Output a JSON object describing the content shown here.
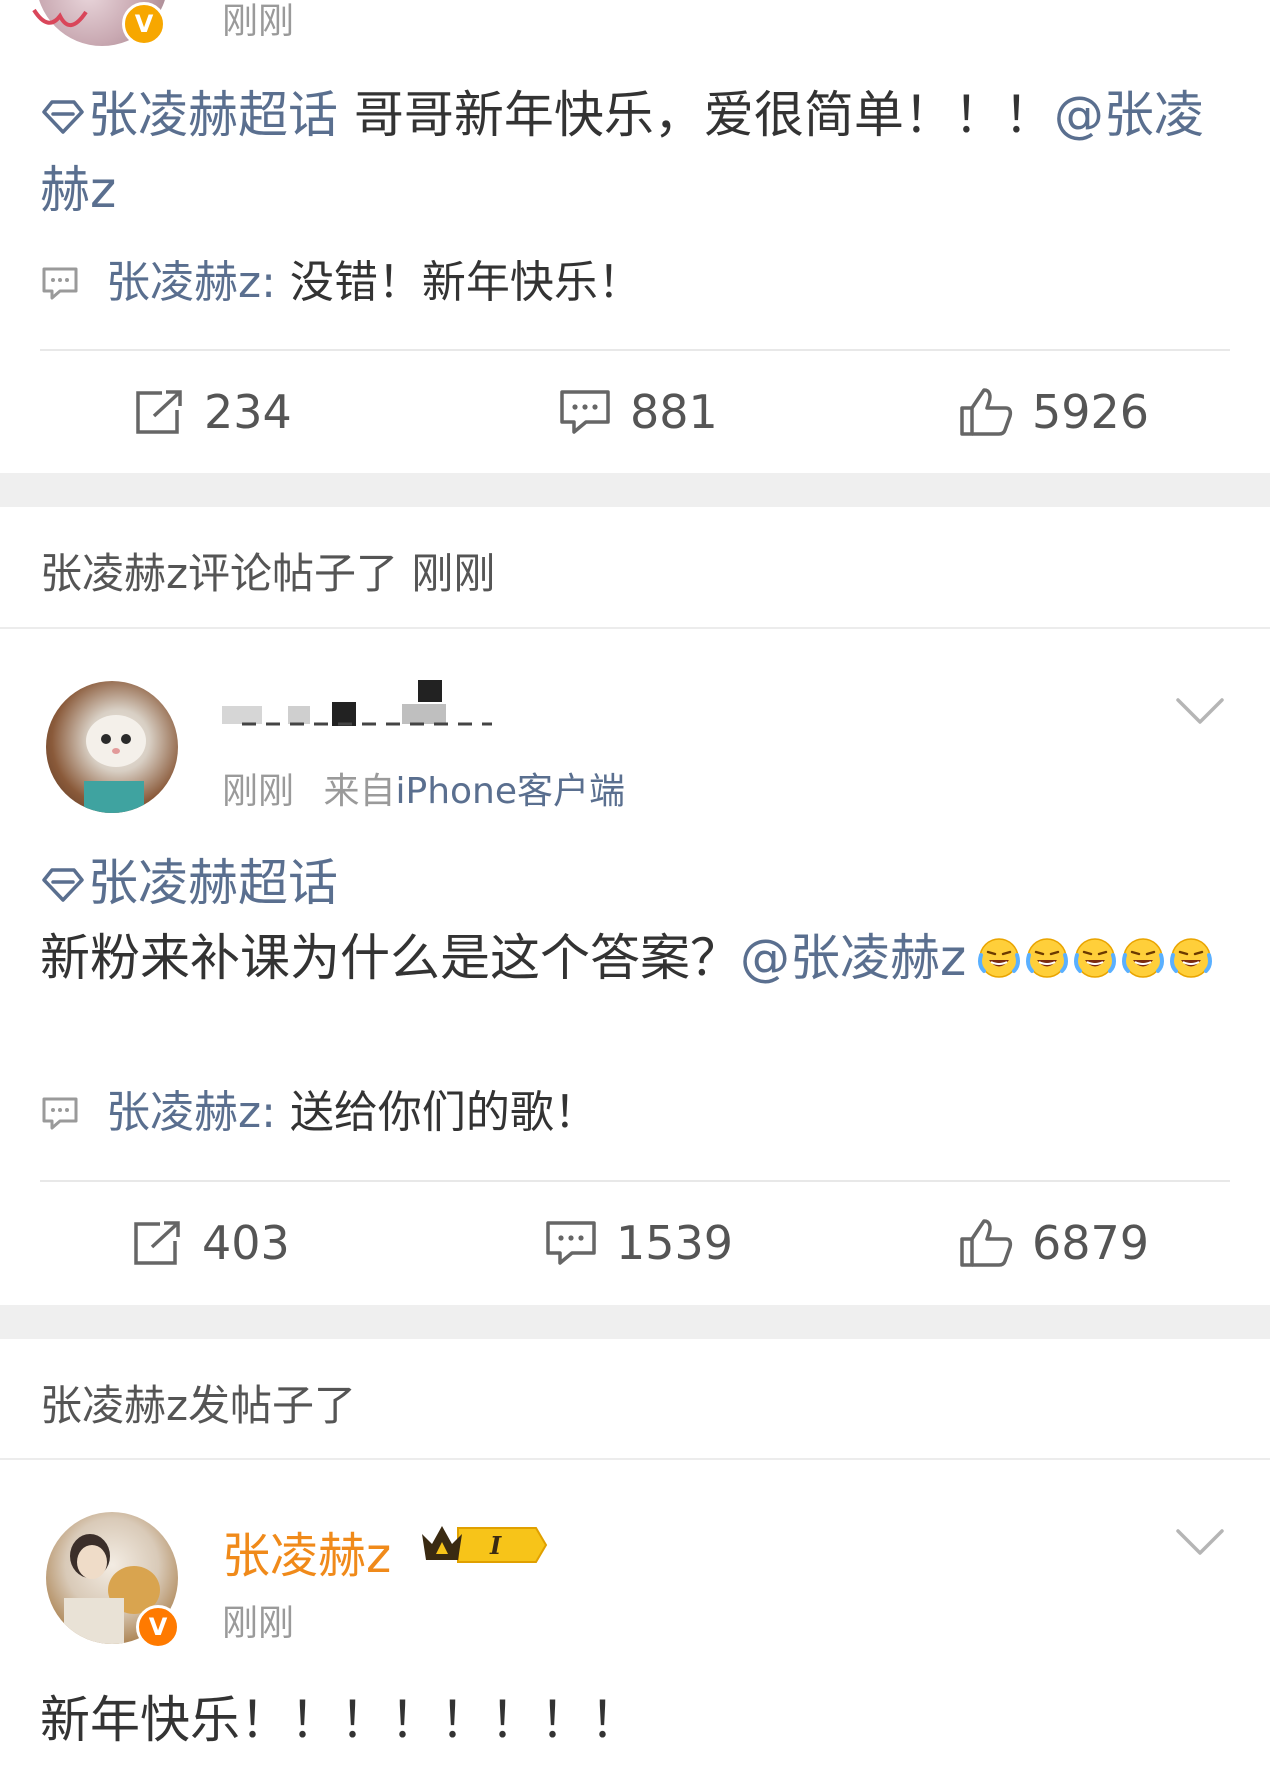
{
  "posts": [
    {
      "time": "刚刚",
      "topic": "张凌赫超话",
      "text": " 哥哥新年快乐，爱很简单！！！",
      "mention": "@张凌赫z",
      "reply": {
        "author": "张凌赫z:",
        "text": " 没错！新年快乐！"
      },
      "actions": {
        "repost": "234",
        "comment": "881",
        "like": "5926"
      }
    },
    {
      "section_label": "张凌赫z评论帖子了 刚刚",
      "time": "刚刚",
      "source_prefix": "来自",
      "source": "iPhone客户端",
      "topic": "张凌赫超话",
      "text": "新粉来补课为什么是这个答案？",
      "mention": "@张凌赫z",
      "emoji_count": 5,
      "reply": {
        "author": "张凌赫z:",
        "text": " 送给你们的歌！"
      },
      "actions": {
        "repost": "403",
        "comment": "1539",
        "like": "6879"
      }
    },
    {
      "section_label": "张凌赫z发帖子了",
      "author": "张凌赫z",
      "level_badge": "I",
      "time": "刚刚",
      "text": "新年快乐！！！！！！！！"
    }
  ],
  "icons": {
    "topic": "topic-diamond-icon",
    "reply": "comment-bubble-icon",
    "repost": "repost-icon",
    "comment": "comment-icon",
    "like": "thumbs-up-icon",
    "verified": "verified-v-icon",
    "more": "chevron-down-icon",
    "emoji": "laughing-crying-emoji"
  },
  "colors": {
    "link": "#5a6f8f",
    "author_orange": "#f08a1a",
    "verified": "#f7a700",
    "time_gray": "#9a9a9a"
  }
}
